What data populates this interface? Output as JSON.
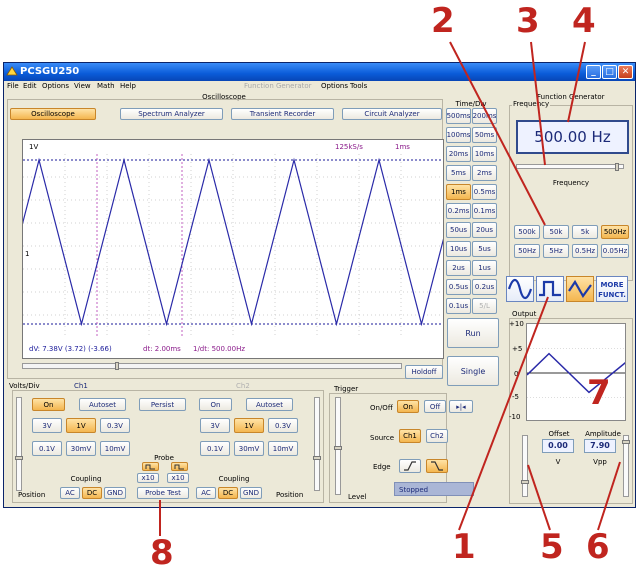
{
  "annotations": [
    "2",
    "3",
    "4",
    "7",
    "1",
    "5",
    "6",
    "8"
  ],
  "window": {
    "title": "PCSGU250"
  },
  "menu": {
    "left": [
      "File",
      "Edit",
      "Options",
      "View",
      "Math",
      "Help"
    ],
    "func_gen": "Function Generator",
    "right": [
      "Options",
      "Tools"
    ]
  },
  "oscilloscope_label": "Oscilloscope",
  "modes": [
    "Oscilloscope",
    "Spectrum Analyzer",
    "Transient Recorder",
    "Circuit Analyzer"
  ],
  "scope": {
    "channel": "1V",
    "samplerate": "125kS/s",
    "timebase": "1ms",
    "marker": "1",
    "readout": {
      "dv": "dV: 7.38V  (3.72) (-3.66)",
      "dt": "dt: 2.00ms",
      "freq": "1/dt: 500.00Hz"
    }
  },
  "timediv": {
    "title": "Time/Div",
    "buttons": [
      [
        "500ms",
        "200ms"
      ],
      [
        "100ms",
        "50ms"
      ],
      [
        "20ms",
        "10ms"
      ],
      [
        "5ms",
        "2ms"
      ],
      [
        "1ms",
        "0.5ms"
      ],
      [
        "0.2ms",
        "0.1ms"
      ],
      [
        "50us",
        "20us"
      ],
      [
        "10us",
        "5us"
      ],
      [
        "2us",
        "1us"
      ],
      [
        "0.5us",
        "0.2us"
      ],
      [
        "0.1us",
        "5/L"
      ]
    ]
  },
  "run_label": "Run",
  "single_label": "Single",
  "holdoff_label": "Holdoff",
  "volts": {
    "title": "Volts/Div",
    "ch1": "Ch1",
    "ch2": "Ch2",
    "on": "On",
    "autoset": "Autoset",
    "persist": "Persist",
    "v_row1": [
      "3V",
      "1V",
      "0.3V"
    ],
    "v_row2": [
      "0.1V",
      "30mV",
      "10mV"
    ],
    "probe": "Probe",
    "x10": "x10",
    "probe_test": "Probe Test",
    "coupling": "Coupling",
    "position": "Position",
    "coupling_opts": [
      "AC",
      "DC",
      "GND"
    ]
  },
  "trigger": {
    "title": "Trigger",
    "onoff_label": "On/Off",
    "on": "On",
    "off": "Off",
    "skip": "▸|◂",
    "source_label": "Source",
    "ch1": "Ch1",
    "ch2": "Ch2",
    "edge_label": "Edge",
    "level_label": "Level",
    "status": "Stopped"
  },
  "funcgen": {
    "title": "Function Generator",
    "frequency_group": "Frequency",
    "frequency_value": "500.00 Hz",
    "frequency_label": "Frequency",
    "range_row1": [
      "500k",
      "50k",
      "5k",
      "500Hz"
    ],
    "range_row2": [
      "50Hz",
      "5Hz",
      "0.5Hz",
      "0.05Hz"
    ],
    "more": "MORE FUNCT.",
    "output_group": "Output",
    "y_ticks": [
      "+10",
      "+5",
      "0",
      "-5",
      "-10"
    ],
    "offset_label": "Offset",
    "offset_value": "0.00",
    "offset_unit": "V",
    "amplitude_label": "Amplitude",
    "amplitude_value": "7.90",
    "amplitude_unit": "Vpp"
  }
}
